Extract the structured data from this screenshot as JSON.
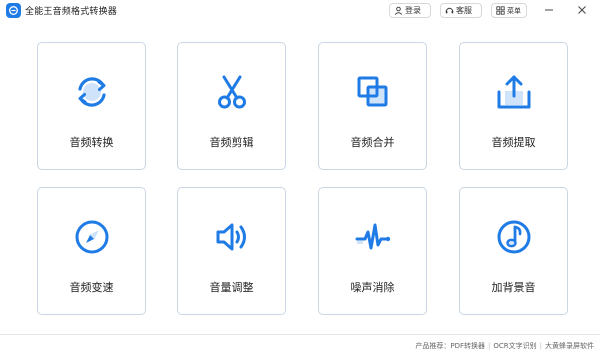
{
  "app": {
    "title": "全能王音频格式转换器"
  },
  "header": {
    "login_label": "登录",
    "service_label": "客服",
    "menu_label": "菜单"
  },
  "cards": [
    {
      "label": "音频转换",
      "icon": "convert-arrows-icon"
    },
    {
      "label": "音频剪辑",
      "icon": "scissors-icon"
    },
    {
      "label": "音频合并",
      "icon": "merge-squares-icon"
    },
    {
      "label": "音频提取",
      "icon": "extract-upload-icon"
    },
    {
      "label": "音频变速",
      "icon": "compass-speed-icon"
    },
    {
      "label": "音量调整",
      "icon": "volume-speaker-icon"
    },
    {
      "label": "噪声消除",
      "icon": "waveform-noise-icon"
    },
    {
      "label": "加背景音",
      "icon": "music-note-circle-icon"
    }
  ],
  "footer": {
    "prefix": "产品推荐：",
    "links": [
      "PDF转换器",
      "OCR文字识别",
      "大黄蜂录屏软件"
    ]
  },
  "colors": {
    "accent": "#1f7be6",
    "accent_light": "#cfe3fb",
    "border": "#c9d6e3"
  }
}
